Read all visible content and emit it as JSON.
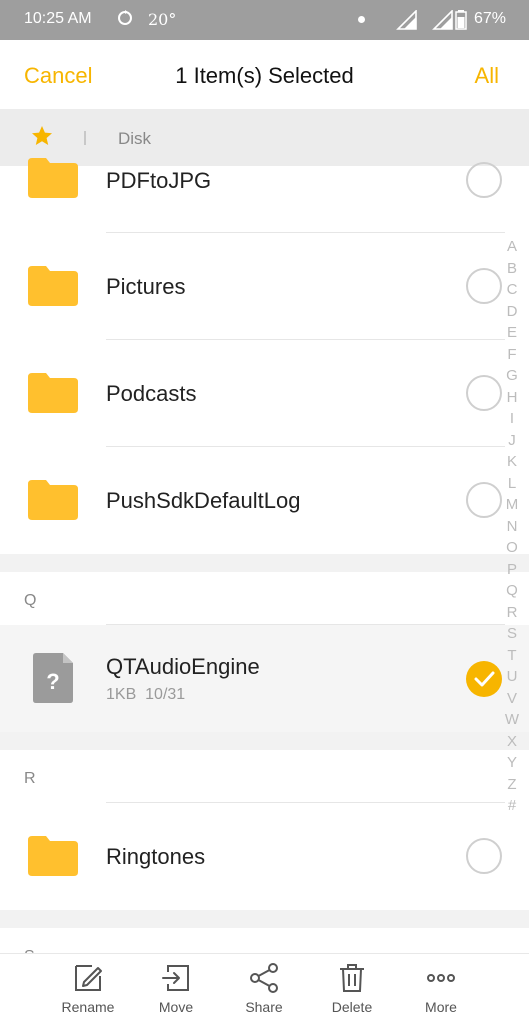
{
  "status_bar": {
    "time": "10:25 AM",
    "temperature": "20°",
    "battery": "67%"
  },
  "header": {
    "cancel_label": "Cancel",
    "title": "1 Item(s) Selected",
    "all_label": "All"
  },
  "breadcrumb": {
    "current": "Disk"
  },
  "items": [
    {
      "name": "PDFtoJPG",
      "type": "folder",
      "selected": false
    },
    {
      "name": "Pictures",
      "type": "folder",
      "selected": false
    },
    {
      "name": "Podcasts",
      "type": "folder",
      "selected": false
    },
    {
      "name": "PushSdkDefaultLog",
      "type": "folder",
      "selected": false
    },
    {
      "name": "QTAudioEngine",
      "type": "file",
      "size": "1KB",
      "date": "10/31",
      "selected": true
    },
    {
      "name": "Ringtones",
      "type": "folder",
      "selected": false
    }
  ],
  "sections": {
    "q": "Q",
    "r": "R",
    "s": "S"
  },
  "index_letters": [
    "A",
    "B",
    "C",
    "D",
    "E",
    "F",
    "G",
    "H",
    "I",
    "J",
    "K",
    "L",
    "M",
    "N",
    "O",
    "P",
    "Q",
    "R",
    "S",
    "T",
    "U",
    "V",
    "W",
    "X",
    "Y",
    "Z",
    "#"
  ],
  "toolbar": {
    "rename": "Rename",
    "move": "Move",
    "share": "Share",
    "delete": "Delete",
    "more": "More"
  },
  "colors": {
    "accent": "#f7b500",
    "folder": "#ffc02e",
    "status_bar": "#9e9e9e"
  }
}
